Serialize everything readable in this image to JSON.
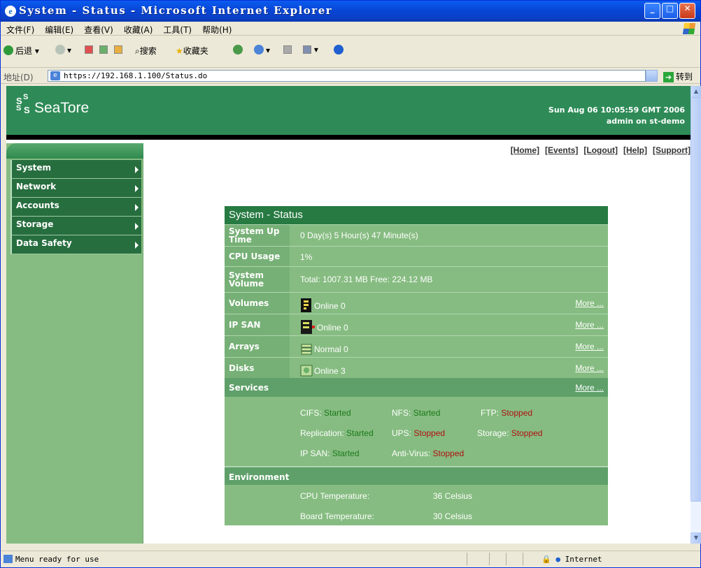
{
  "window": {
    "title": "System - Status - Microsoft Internet Explorer"
  },
  "menu": [
    "文件(F)",
    "编辑(E)",
    "查看(V)",
    "收藏(A)",
    "工具(T)",
    "帮助(H)"
  ],
  "toolbar": {
    "back": "后退",
    "search": "搜索",
    "favorites": "收藏夹"
  },
  "address": {
    "label": "地址(D)",
    "url": "https://192.168.1.100/Status.do",
    "go": "转到"
  },
  "header": {
    "logo": "SeaTore",
    "datetime": "Sun Aug 06 10:05:59 GMT 2006",
    "user": "admin on st-demo"
  },
  "sidebar": {
    "items": [
      "System",
      "Network",
      "Accounts",
      "Storage",
      "Data Safety"
    ]
  },
  "toplinks": [
    "[Home]",
    "[Events]",
    "[Logout]",
    "[Help]",
    "[Support]"
  ],
  "panel": {
    "title": "System - Status",
    "uptime": {
      "label": "System Up Time",
      "value": "0 Day(s) 5 Hour(s) 47 Minute(s)"
    },
    "cpu": {
      "label": "CPU Usage",
      "value": "1%"
    },
    "volume": {
      "label": "System Volume",
      "value": "Total: 1007.31 MB  Free: 224.12 MB"
    },
    "volumes": {
      "label": "Volumes",
      "value": "Online 0",
      "more": "More ..."
    },
    "ipsan": {
      "label": "IP SAN",
      "value": "Online 0",
      "more": "More ..."
    },
    "arrays": {
      "label": "Arrays",
      "value": "Normal 0",
      "more": "More ..."
    },
    "disks": {
      "label": "Disks",
      "value": "Online 3",
      "more": "More ..."
    },
    "services": {
      "label": "Services",
      "more": "More ...",
      "items": [
        {
          "name": "CIFS:",
          "state": "Started"
        },
        {
          "name": "NFS:",
          "state": "Started"
        },
        {
          "name": "FTP:",
          "state": "Stopped"
        },
        {
          "name": "Replication:",
          "state": "Started"
        },
        {
          "name": "UPS:",
          "state": "Stopped"
        },
        {
          "name": "Storage:",
          "state": "Stopped"
        },
        {
          "name": "IP SAN:",
          "state": "Started"
        },
        {
          "name": "Anti-Virus:",
          "state": "Stopped"
        }
      ]
    },
    "environment": {
      "label": "Environment",
      "cpu_temp": {
        "name": "CPU Temperature:",
        "value": "36 Celsius"
      },
      "board_temp": {
        "name": "Board Temperature:",
        "value": "30 Celsius"
      }
    }
  },
  "status": {
    "message": "Menu ready for use",
    "zone": "Internet"
  },
  "colors": {
    "header": "#2e8b57",
    "sidebar": "#86bc81",
    "started": "#1a7a1a",
    "stopped": "#b01010"
  }
}
